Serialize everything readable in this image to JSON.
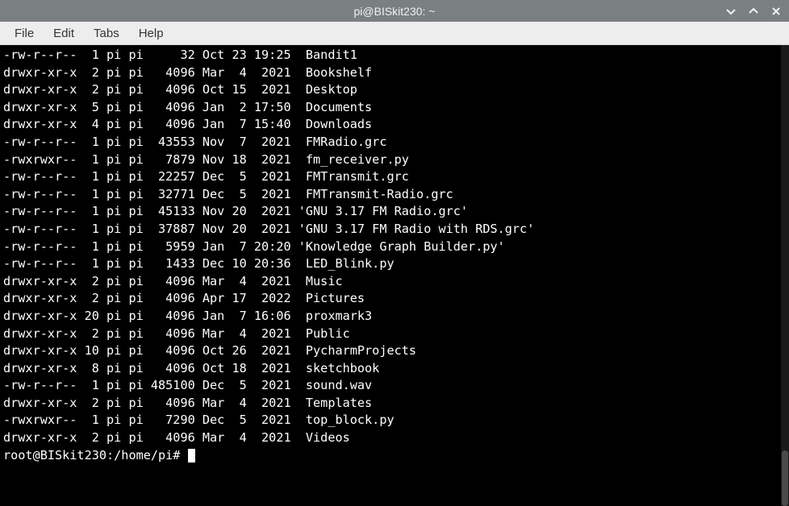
{
  "title": "pi@BISkit230: ~",
  "menu": {
    "file": "File",
    "edit": "Edit",
    "tabs": "Tabs",
    "help": "Help"
  },
  "listing": [
    {
      "perm": "-rw-r--r--",
      "links": "1",
      "owner": "pi",
      "group": "pi",
      "size": "32",
      "month": "Oct",
      "day": "23",
      "time": "19:25",
      "name": " Bandit1"
    },
    {
      "perm": "drwxr-xr-x",
      "links": "2",
      "owner": "pi",
      "group": "pi",
      "size": "4096",
      "month": "Mar",
      "day": "4",
      "time": "2021",
      "name": " Bookshelf"
    },
    {
      "perm": "drwxr-xr-x",
      "links": "2",
      "owner": "pi",
      "group": "pi",
      "size": "4096",
      "month": "Oct",
      "day": "15",
      "time": "2021",
      "name": " Desktop"
    },
    {
      "perm": "drwxr-xr-x",
      "links": "5",
      "owner": "pi",
      "group": "pi",
      "size": "4096",
      "month": "Jan",
      "day": "2",
      "time": "17:50",
      "name": " Documents"
    },
    {
      "perm": "drwxr-xr-x",
      "links": "4",
      "owner": "pi",
      "group": "pi",
      "size": "4096",
      "month": "Jan",
      "day": "7",
      "time": "15:40",
      "name": " Downloads"
    },
    {
      "perm": "-rw-r--r--",
      "links": "1",
      "owner": "pi",
      "group": "pi",
      "size": "43553",
      "month": "Nov",
      "day": "7",
      "time": "2021",
      "name": " FMRadio.grc"
    },
    {
      "perm": "-rwxrwxr--",
      "links": "1",
      "owner": "pi",
      "group": "pi",
      "size": "7879",
      "month": "Nov",
      "day": "18",
      "time": "2021",
      "name": " fm_receiver.py"
    },
    {
      "perm": "-rw-r--r--",
      "links": "1",
      "owner": "pi",
      "group": "pi",
      "size": "22257",
      "month": "Dec",
      "day": "5",
      "time": "2021",
      "name": " FMTransmit.grc"
    },
    {
      "perm": "-rw-r--r--",
      "links": "1",
      "owner": "pi",
      "group": "pi",
      "size": "32771",
      "month": "Dec",
      "day": "5",
      "time": "2021",
      "name": " FMTransmit-Radio.grc"
    },
    {
      "perm": "-rw-r--r--",
      "links": "1",
      "owner": "pi",
      "group": "pi",
      "size": "45133",
      "month": "Nov",
      "day": "20",
      "time": "2021",
      "name": "'GNU 3.17 FM Radio.grc'"
    },
    {
      "perm": "-rw-r--r--",
      "links": "1",
      "owner": "pi",
      "group": "pi",
      "size": "37887",
      "month": "Nov",
      "day": "20",
      "time": "2021",
      "name": "'GNU 3.17 FM Radio with RDS.grc'"
    },
    {
      "perm": "-rw-r--r--",
      "links": "1",
      "owner": "pi",
      "group": "pi",
      "size": "5959",
      "month": "Jan",
      "day": "7",
      "time": "20:20",
      "name": "'Knowledge Graph Builder.py'"
    },
    {
      "perm": "-rw-r--r--",
      "links": "1",
      "owner": "pi",
      "group": "pi",
      "size": "1433",
      "month": "Dec",
      "day": "10",
      "time": "20:36",
      "name": " LED_Blink.py"
    },
    {
      "perm": "drwxr-xr-x",
      "links": "2",
      "owner": "pi",
      "group": "pi",
      "size": "4096",
      "month": "Mar",
      "day": "4",
      "time": "2021",
      "name": " Music"
    },
    {
      "perm": "drwxr-xr-x",
      "links": "2",
      "owner": "pi",
      "group": "pi",
      "size": "4096",
      "month": "Apr",
      "day": "17",
      "time": "2022",
      "name": " Pictures"
    },
    {
      "perm": "drwxr-xr-x",
      "links": "20",
      "owner": "pi",
      "group": "pi",
      "size": "4096",
      "month": "Jan",
      "day": "7",
      "time": "16:06",
      "name": " proxmark3"
    },
    {
      "perm": "drwxr-xr-x",
      "links": "2",
      "owner": "pi",
      "group": "pi",
      "size": "4096",
      "month": "Mar",
      "day": "4",
      "time": "2021",
      "name": " Public"
    },
    {
      "perm": "drwxr-xr-x",
      "links": "10",
      "owner": "pi",
      "group": "pi",
      "size": "4096",
      "month": "Oct",
      "day": "26",
      "time": "2021",
      "name": " PycharmProjects"
    },
    {
      "perm": "drwxr-xr-x",
      "links": "8",
      "owner": "pi",
      "group": "pi",
      "size": "4096",
      "month": "Oct",
      "day": "18",
      "time": "2021",
      "name": " sketchbook"
    },
    {
      "perm": "-rw-r--r--",
      "links": "1",
      "owner": "pi",
      "group": "pi",
      "size": "485100",
      "month": "Dec",
      "day": "5",
      "time": "2021",
      "name": " sound.wav"
    },
    {
      "perm": "drwxr-xr-x",
      "links": "2",
      "owner": "pi",
      "group": "pi",
      "size": "4096",
      "month": "Mar",
      "day": "4",
      "time": "2021",
      "name": " Templates"
    },
    {
      "perm": "-rwxrwxr--",
      "links": "1",
      "owner": "pi",
      "group": "pi",
      "size": "7290",
      "month": "Dec",
      "day": "5",
      "time": "2021",
      "name": " top_block.py"
    },
    {
      "perm": "drwxr-xr-x",
      "links": "2",
      "owner": "pi",
      "group": "pi",
      "size": "4096",
      "month": "Mar",
      "day": "4",
      "time": "2021",
      "name": " Videos"
    }
  ],
  "prompt": "root@BISkit230:/home/pi# "
}
